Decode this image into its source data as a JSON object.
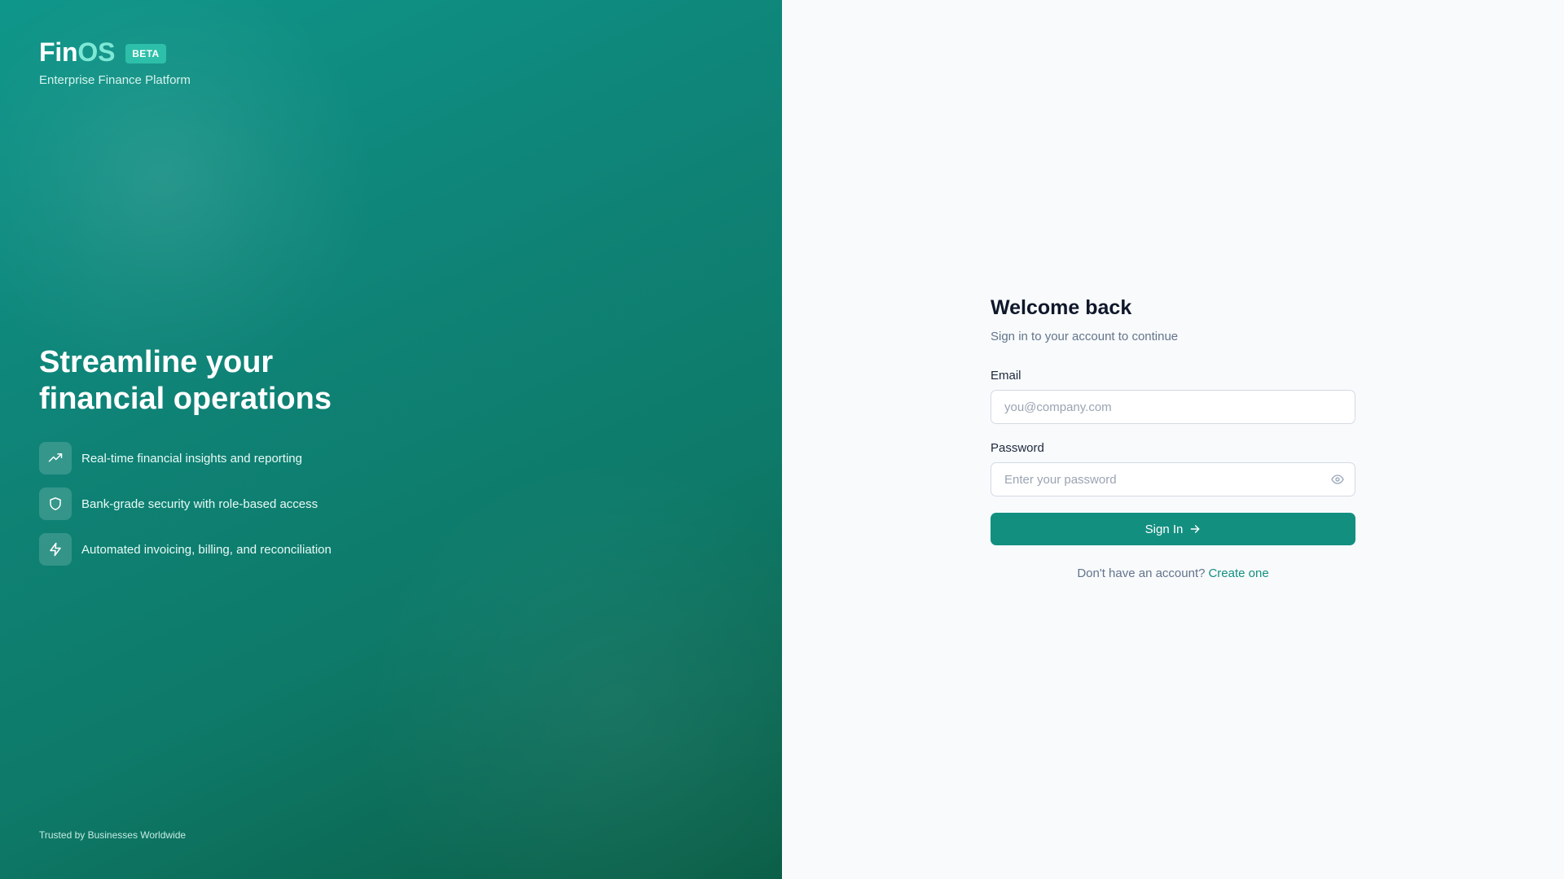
{
  "brand": {
    "name_part1": "Fin",
    "name_part2": "OS",
    "badge": "BETA",
    "tagline": "Enterprise Finance Platform"
  },
  "hero": {
    "title": "Streamline your financial operations",
    "features": [
      {
        "icon": "trending-up-icon",
        "text": "Real-time financial insights and reporting"
      },
      {
        "icon": "shield-icon",
        "text": "Bank-grade security with role-based access"
      },
      {
        "icon": "lightning-icon",
        "text": "Automated invoicing, billing, and reconciliation"
      }
    ]
  },
  "footer": {
    "trusted": "Trusted by Businesses Worldwide"
  },
  "login": {
    "title": "Welcome back",
    "subtitle": "Sign in to your account to continue",
    "email_label": "Email",
    "email_placeholder": "you@company.com",
    "email_value": "",
    "password_label": "Password",
    "password_placeholder": "Enter your password",
    "password_value": "",
    "submit_label": "Sign In",
    "signup_prompt": "Don't have an account?",
    "signup_link": "Create one"
  },
  "colors": {
    "brand_green": "#138f80",
    "accent_mint": "#7ee8d6",
    "badge_bg": "#2dbfa9"
  }
}
